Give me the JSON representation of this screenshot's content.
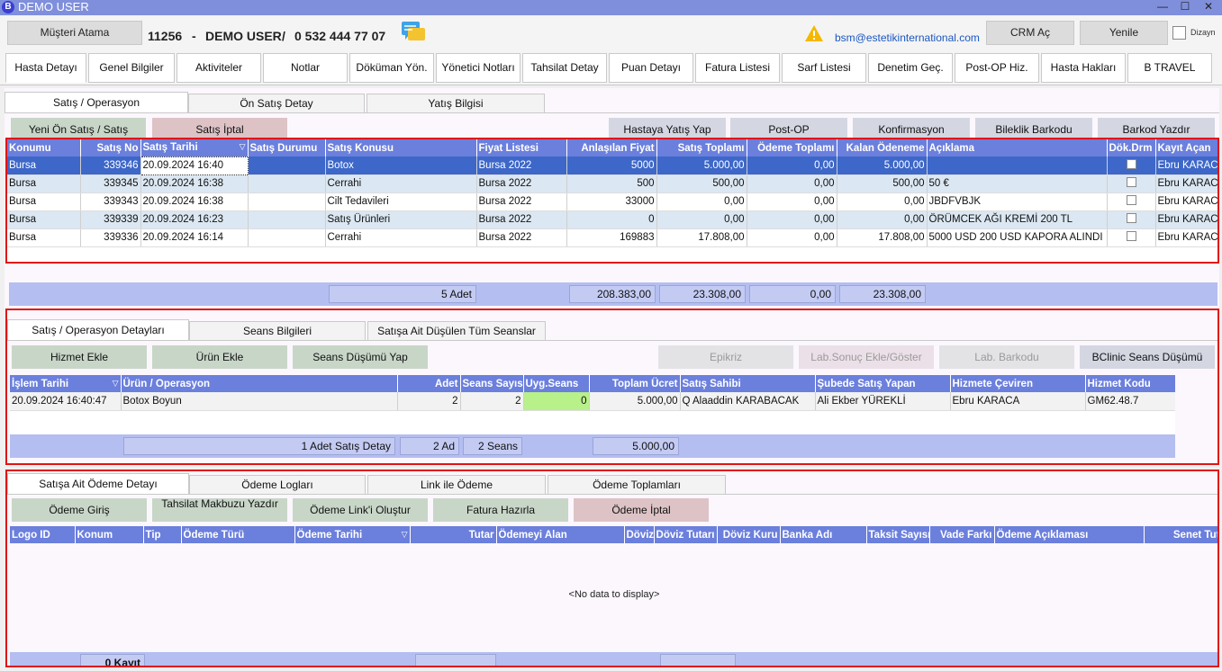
{
  "window": {
    "title": "DEMO USER",
    "logo_letter": "B",
    "min": "—",
    "max": "☐",
    "close": "✕"
  },
  "header": {
    "musteri_atama": "Müşteri Atama",
    "patient_id": "11256",
    "sep1": "-",
    "patient_name": "DEMO USER",
    "sep2": "/",
    "phone": "0 532 444 77 07",
    "email": "bsm@estetikinternational.com",
    "crm": "CRM Aç",
    "refresh": "Yenile",
    "design": "Dizayn"
  },
  "tabs": [
    "Hasta Detayı",
    "Genel Bilgiler",
    "Aktiviteler",
    "Notlar",
    "Döküman Yön.",
    "Yönetici Notları",
    "Tahsilat Detay",
    "Puan Detayı",
    "Fatura Listesi",
    "Sarf Listesi",
    "Denetim Geç.",
    "Post-OP Hiz.",
    "Hasta Hakları",
    "B TRAVEL"
  ],
  "sales": {
    "subtabs": [
      "Satış / Operasyon",
      "Ön Satış Detay",
      "Yatış Bilgisi"
    ],
    "buttons": {
      "new_presale": "Yeni Ön Satış / Satış",
      "cancel_sale": "Satış İptal",
      "admit": "Hastaya Yatış Yap",
      "postop": "Post-OP",
      "confirm": "Konfirmasyon",
      "bracelet": "Bileklik Barkodu",
      "barcode": "Barkod Yazdır"
    },
    "columns": [
      "Konumu",
      "Satış No",
      "Satış Tarihi",
      "Satış Durumu",
      "Satış Konusu",
      "Fiyat Listesi",
      "Anlaşılan Fiyat",
      "Satış Toplamı",
      "Ödeme Toplamı",
      "Kalan Ödeneme",
      "Açıklama",
      "Dök.Drm",
      "Kayıt Açan"
    ],
    "rows": [
      {
        "konum": "Bursa",
        "no": "339346",
        "tarih": "20.09.2024 16:40",
        "durum": "",
        "konu": "Botox",
        "fiyat": "Bursa 2022",
        "anlasilan": "5000",
        "toplam": "5.000,00",
        "odeme": "0,00",
        "kalan": "5.000,00",
        "aciklama": "",
        "acan": "Ebru KARACA"
      },
      {
        "konum": "Bursa",
        "no": "339345",
        "tarih": "20.09.2024 16:38",
        "durum": "",
        "konu": "Cerrahi",
        "fiyat": "Bursa 2022",
        "anlasilan": "500",
        "toplam": "500,00",
        "odeme": "0,00",
        "kalan": "500,00",
        "aciklama": "50 €",
        "acan": "Ebru KARACA"
      },
      {
        "konum": "Bursa",
        "no": "339343",
        "tarih": "20.09.2024 16:38",
        "durum": "",
        "konu": "Cilt Tedavileri",
        "fiyat": "Bursa 2022",
        "anlasilan": "33000",
        "toplam": "0,00",
        "odeme": "0,00",
        "kalan": "0,00",
        "aciklama": "JBDFVBJK",
        "acan": "Ebru KARACA"
      },
      {
        "konum": "Bursa",
        "no": "339339",
        "tarih": "20.09.2024 16:23",
        "durum": "",
        "konu": "Satış Ürünleri",
        "fiyat": "Bursa 2022",
        "anlasilan": "0",
        "toplam": "0,00",
        "odeme": "0,00",
        "kalan": "0,00",
        "aciklama": "ÖRÜMCEK AĞI KREMİ 200 TL",
        "acan": "Ebru KARACA"
      },
      {
        "konum": "Bursa",
        "no": "339336",
        "tarih": "20.09.2024 16:14",
        "durum": "",
        "konu": "Cerrahi",
        "fiyat": "Bursa 2022",
        "anlasilan": "169883",
        "toplam": "17.808,00",
        "odeme": "0,00",
        "kalan": "17.808,00",
        "aciklama": "5000 USD 200 USD KAPORA ALINDI",
        "acan": "Ebru KARACA"
      }
    ],
    "footer": {
      "count": "5 Adet",
      "anlasilan": "208.383,00",
      "toplam": "23.308,00",
      "odeme": "0,00",
      "kalan": "23.308,00"
    }
  },
  "details": {
    "subtabs": [
      "Satış / Operasyon Detayları",
      "Seans Bilgileri",
      "Satışa Ait Düşülen Tüm Seanslar"
    ],
    "buttons": {
      "add_service": "Hizmet Ekle",
      "add_product": "Ürün Ekle",
      "session_drop": "Seans Düşümü Yap",
      "epikriz": "Epikriz",
      "lab_result": "Lab.Sonuç Ekle/Göster",
      "lab_barcode": "Lab. Barkodu",
      "bclinic": "BClinic Seans Düşümü"
    },
    "columns": [
      "İşlem Tarihi",
      "Ürün / Operasyon",
      "Adet",
      "Seans Sayısı",
      "Uyg.Seans",
      "Toplam Ücret",
      "Satış Sahibi",
      "Şubede Satış Yapan",
      "Hizmete Çeviren",
      "Hizmet Kodu"
    ],
    "rows": [
      {
        "tarih": "20.09.2024 16:40:47",
        "urun": "Botox Boyun",
        "adet": "2",
        "seans": "2",
        "uyg": "0",
        "ucret": "5.000,00",
        "sahibi": "Q Alaaddin KARABACAK",
        "sube": "Ali Ekber YÜREKLİ",
        "ceviren": "Ebru KARACA",
        "kod": "GM62.48.7"
      }
    ],
    "footer": {
      "count": "1 Adet Satış Detay",
      "adet": "2 Ad",
      "seans": "2 Seans",
      "ucret": "5.000,00"
    }
  },
  "payments": {
    "subtabs": [
      "Satışa Ait Ödeme Detayı",
      "Ödeme Logları",
      "Link ile Ödeme",
      "Ödeme Toplamları"
    ],
    "buttons": {
      "pay_entry": "Ödeme Giriş",
      "receipt": "Tahsilat Makbuzu Yazdır",
      "pay_link": "Ödeme Link'i Oluştur",
      "invoice": "Fatura Hazırla",
      "pay_cancel": "Ödeme İptal"
    },
    "columns": [
      "Logo ID",
      "Konum",
      "Tip",
      "Ödeme Türü",
      "Ödeme Tarihi",
      "Tutar",
      "Ödemeyi Alan",
      "Döviz",
      "Döviz Tutarı",
      "Döviz Kuru",
      "Banka Adı",
      "Taksit Sayısı",
      "Vade Farkı",
      "Ödeme Açıklaması",
      "Senet Tutarı"
    ],
    "empty": "<No data to display>",
    "footer": {
      "count": "0 Kayıt"
    }
  },
  "colors": {
    "header_blue": "#6b7fdc",
    "selected_row": "#3d67c8",
    "highlight_red": "#e01414"
  }
}
